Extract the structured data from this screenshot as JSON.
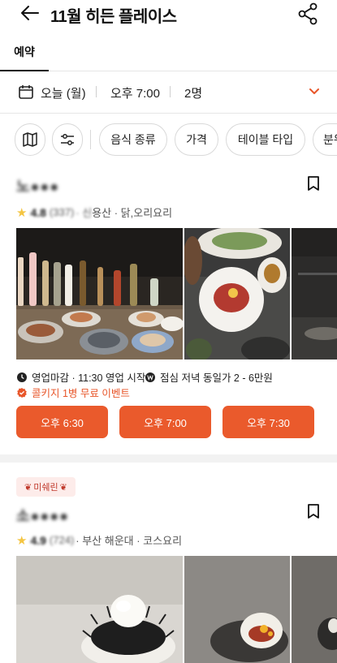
{
  "header": {
    "title": "11월 히든 플레이스"
  },
  "tabs": [
    {
      "label": "예약",
      "active": true
    }
  ],
  "filters": {
    "date": "오늘 (월)",
    "time": "오후 7:00",
    "people": "2명"
  },
  "chips": [
    "음식 종류",
    "가격",
    "테이블 타입",
    "분위"
  ],
  "restaurants": [
    {
      "name": "노●●●",
      "rating": "4.8",
      "reviews": "(337)",
      "area_blur": "· 신",
      "area": "용산 · 닭,오리요리",
      "hours": "영업마감 · 11:30 영업 시작",
      "price": "점심 저녁 동일가 2 - 6만원",
      "promo": "콜키지 1병 무료 이벤트",
      "slots": [
        "오후 6:30",
        "오후 7:00",
        "오후 7:30"
      ]
    },
    {
      "badge": "미쉐린",
      "name": "소●●●●",
      "rating": "4.9",
      "reviews": "(724)",
      "area": "· 부산 해운대 · 코스요리"
    }
  ],
  "colors": {
    "accent": "#ea5a2c",
    "star": "#f4c542"
  }
}
